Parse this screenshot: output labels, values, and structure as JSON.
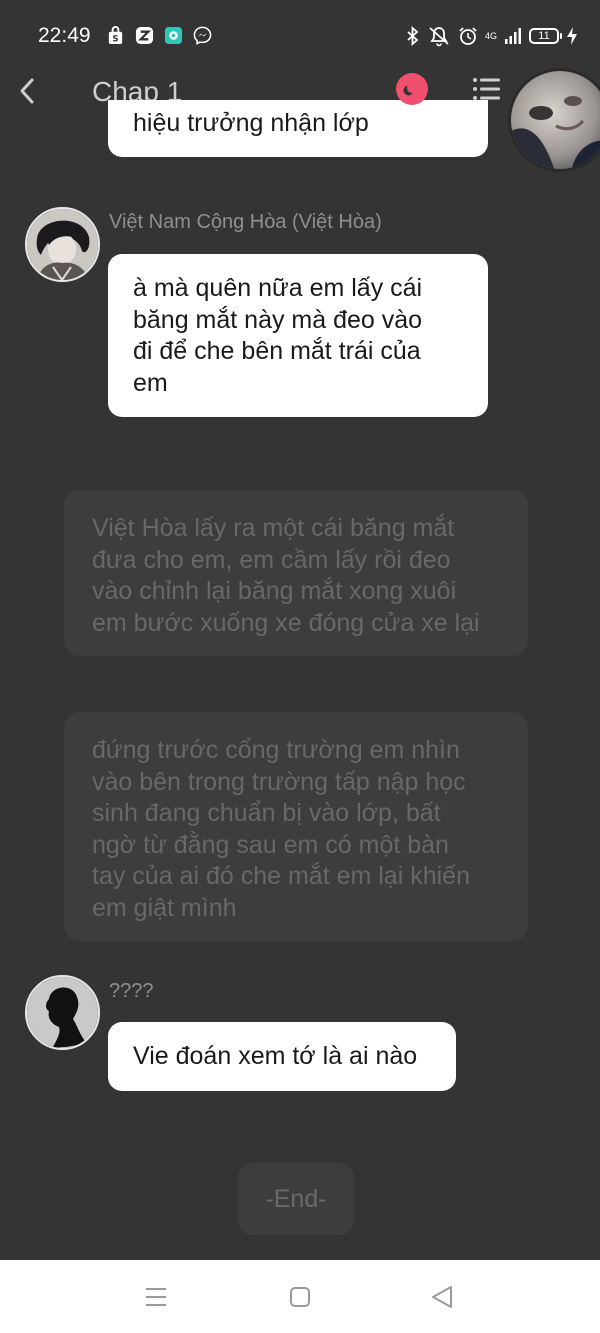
{
  "status_bar": {
    "time": "22:49",
    "network_label": "4G",
    "battery": "11",
    "notification_icons": [
      "shopping-bag-icon",
      "zalo-icon",
      "app-icon",
      "messenger-icon"
    ],
    "system_icons": [
      "bluetooth-icon",
      "mute-icon",
      "alarm-icon",
      "signal-icon",
      "battery-icon",
      "charging-icon"
    ]
  },
  "header": {
    "title": "Chap 1",
    "back_icon": "chevron-left-icon",
    "night_mode_icon": "moon-icon",
    "menu_icon": "list-icon",
    "accent_color": "#f0506e"
  },
  "chat": {
    "cut_off_message": "hiệu trưởng nhận lớp",
    "messages": [
      {
        "speaker": "Việt Nam Cộng Hòa (Việt Hòa)",
        "lines": [
          "à mà quên nữa em lấy cái",
          "băng mắt này mà đeo vào",
          "đi để che bên mắt trái của",
          "em"
        ]
      },
      {
        "speaker": "????",
        "lines": [
          "Vie đoán xem tớ là ai nào"
        ]
      }
    ],
    "narrations": [
      {
        "lines": [
          "Việt Hòa lấy ra một cái băng mắt",
          "đưa cho em, em cầm lấy rồi đeo",
          "vào chỉnh lại băng mắt xong xuôi",
          "em bước xuống xe đóng cửa xe lại"
        ]
      },
      {
        "lines": [
          "đứng trước cổng trường em nhìn",
          "vào bên trong trường tấp nập học",
          "sinh đang chuẩn bị vào lớp, bất",
          "ngờ từ đằng sau em có một bàn",
          "tay của ai đó che mắt em lại khiến",
          "em giật mình"
        ]
      }
    ],
    "end_label": "-End-"
  },
  "nav_bar": {
    "buttons": [
      "menu-icon",
      "home-square-icon",
      "back-triangle-icon"
    ]
  },
  "colors": {
    "background": "#343434",
    "bubble": "#ffffff",
    "narration_bg": "#3d3d3d",
    "narration_text": "#686868"
  }
}
